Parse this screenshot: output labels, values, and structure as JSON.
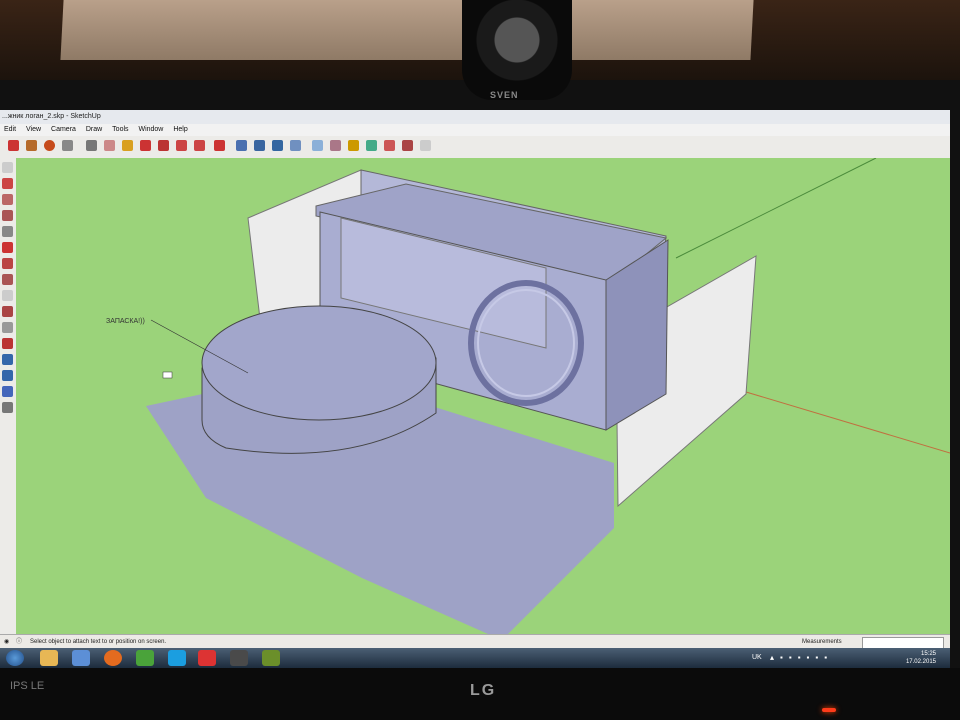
{
  "window": {
    "title": "...жник логан_2.skp - SketchUp"
  },
  "menu": {
    "items": [
      "Edit",
      "View",
      "Camera",
      "Draw",
      "Tools",
      "Window",
      "Help"
    ]
  },
  "viewport": {
    "annotation_text": "ЗАПАСКА!))",
    "background_color": "#9bd37a",
    "model_color": "#a9add1"
  },
  "status": {
    "hint": "Select object to attach text to or position on screen.",
    "measurements_label": "Measurements"
  },
  "taskbar": {
    "language": "UK",
    "time": "15:25",
    "date": "17.02.2015"
  },
  "hardware": {
    "webcam_brand": "SVEN",
    "monitor_brand": "LG",
    "monitor_badge": "IPS LE"
  }
}
